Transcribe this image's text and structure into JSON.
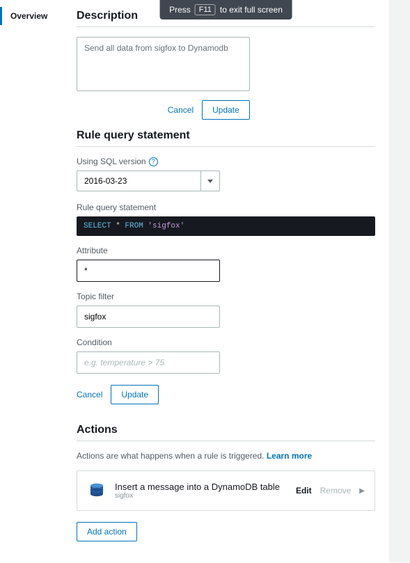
{
  "toast": {
    "pre": "Press",
    "key": "F11",
    "post": "to exit full screen"
  },
  "leftnav": {
    "overview": "Overview"
  },
  "description": {
    "heading": "Description",
    "value": "Send all data from sigfox to Dynamodb",
    "cancel": "Cancel",
    "update": "Update"
  },
  "rqs": {
    "heading": "Rule query statement",
    "sql_label": "Using SQL version",
    "sql_value": "2016-03-23",
    "stmt_label": "Rule query statement",
    "stmt_kw1": "SELECT",
    "stmt_star": " * ",
    "stmt_kw2": "FROM",
    "stmt_str": " 'sigfox'",
    "attr_label": "Attribute",
    "attr_value": "*",
    "topic_label": "Topic filter",
    "topic_value": "sigfox",
    "cond_label": "Condition",
    "cond_placeholder": "e.g. temperature > 75",
    "cancel": "Cancel",
    "update": "Update"
  },
  "actions": {
    "heading": "Actions",
    "hint_pre": "Actions are what happens when a rule is triggered. ",
    "hint_link": "Learn more",
    "item": {
      "title": "Insert a message into a DynamoDB table",
      "sub": "sigfox",
      "edit": "Edit",
      "remove": "Remove"
    },
    "add": "Add action"
  }
}
